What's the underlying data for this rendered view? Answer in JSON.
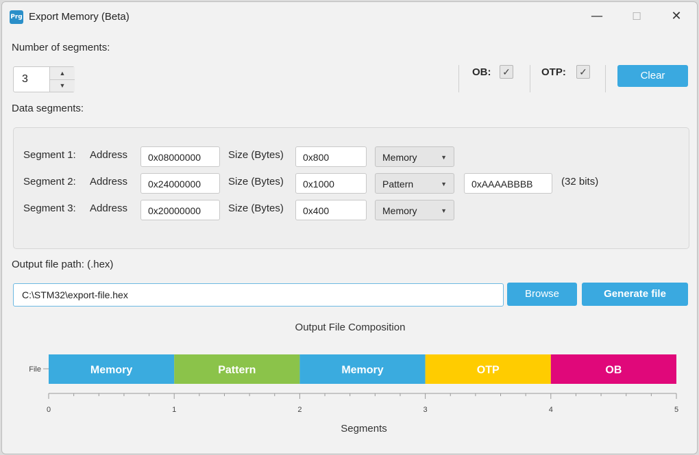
{
  "window": {
    "title": "Export Memory (Beta)",
    "app_icon_text": "Prg",
    "minimize": "—",
    "maximize": "☐",
    "close": "✕"
  },
  "segments_count": {
    "label": "Number of segments:",
    "value": "3"
  },
  "ob": {
    "label": "OB:",
    "checked": true
  },
  "otp": {
    "label": "OTP:",
    "checked": true
  },
  "clear_label": "Clear",
  "data_segments_label": "Data segments:",
  "segments": [
    {
      "label": "Segment 1:",
      "address_label": "Address",
      "address": "0x08000000",
      "size_label": "Size (Bytes)",
      "size": "0x800",
      "type": "Memory"
    },
    {
      "label": "Segment 2:",
      "address_label": "Address",
      "address": "0x24000000",
      "size_label": "Size (Bytes)",
      "size": "0x1000",
      "type": "Pattern",
      "pattern": "0xAAAABBBB",
      "pattern_bits": "(32 bits)"
    },
    {
      "label": "Segment 3:",
      "address_label": "Address",
      "address": "0x20000000",
      "size_label": "Size (Bytes)",
      "size": "0x400",
      "type": "Memory"
    }
  ],
  "output": {
    "label": "Output file path: (.hex)",
    "path": "C:\\STM32\\export-file.hex",
    "browse_label": "Browse",
    "generate_label": "Generate file"
  },
  "chart_data": {
    "type": "bar",
    "title": "Output File Composition",
    "xlabel": "Segments",
    "ylabel": "",
    "categories": [
      "File"
    ],
    "xlim": [
      0,
      5
    ],
    "xticks": [
      "0",
      "1",
      "2",
      "3",
      "4",
      "5"
    ],
    "series": [
      {
        "name": "Memory",
        "start": 0,
        "end": 1,
        "color": "#3aabdf"
      },
      {
        "name": "Pattern",
        "start": 1,
        "end": 2,
        "color": "#8bc34a"
      },
      {
        "name": "Memory",
        "start": 2,
        "end": 3,
        "color": "#3aabdf"
      },
      {
        "name": "OTP",
        "start": 3,
        "end": 4,
        "color": "#ffcc00"
      },
      {
        "name": "OB",
        "start": 4,
        "end": 5,
        "color": "#e0087a"
      }
    ]
  }
}
